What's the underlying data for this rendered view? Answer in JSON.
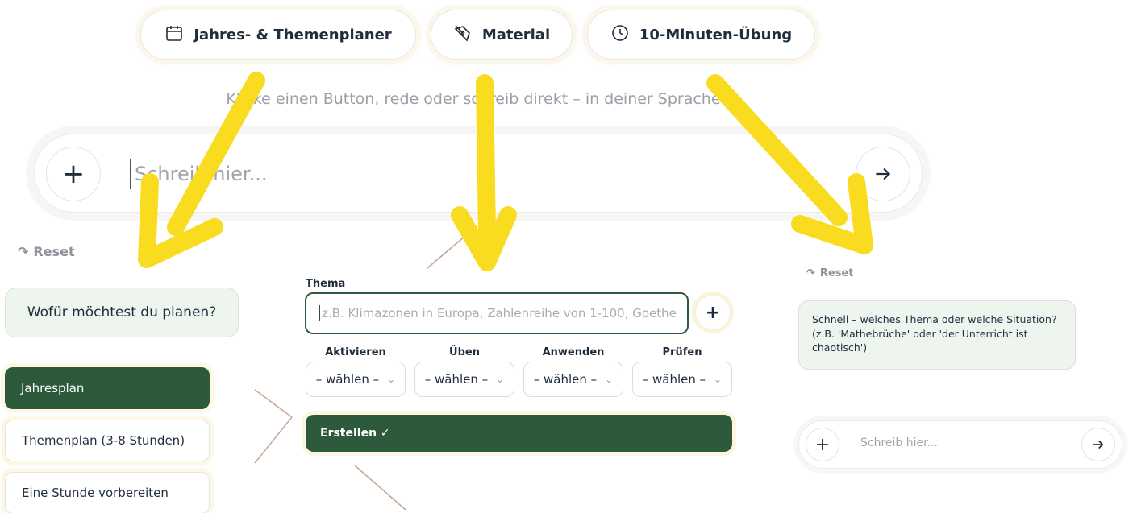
{
  "top_buttons": [
    {
      "label": "Jahres- & Themenplaner",
      "icon": "calendar-icon"
    },
    {
      "label": "Material",
      "icon": "pen-tool-icon"
    },
    {
      "label": "10-Minuten-Übung",
      "icon": "clock-icon"
    }
  ],
  "hint_text": "Klicke einen Button, rede oder schreib direkt – in deiner Sprache.",
  "main_input": {
    "placeholder": "Schreib hier...",
    "plus_icon": "plus-icon",
    "send_icon": "arrow-right-icon"
  },
  "left_panel": {
    "reset_label": "Reset",
    "question": "Wofür möchtest du planen?",
    "options": [
      "Jahresplan",
      "Themenplan (3-8 Stunden)",
      "Eine Stunde vorbereiten"
    ]
  },
  "middle_panel": {
    "topic_label": "Thema",
    "topic_placeholder": "z.B. Klimazonen in Europa, Zahlenreihe von 1-100, Goethe",
    "columns": [
      {
        "header": "Aktivieren",
        "value": "– wählen –"
      },
      {
        "header": "Üben",
        "value": "– wählen –"
      },
      {
        "header": "Anwenden",
        "value": "– wählen –"
      },
      {
        "header": "Prüfen",
        "value": "– wählen –"
      }
    ],
    "create_label": "Erstellen ✓"
  },
  "right_panel": {
    "reset_label": "Reset",
    "message": "Schnell – welches Thema oder welche Situation? (z.B. 'Mathebrüche' oder 'der Unterricht ist chaotisch')",
    "input_placeholder": "Schreib hier..."
  },
  "colors": {
    "accent_green": "#2d5a3b",
    "arrow_yellow": "#f9dc1f",
    "line_brown": "#c8a593"
  }
}
